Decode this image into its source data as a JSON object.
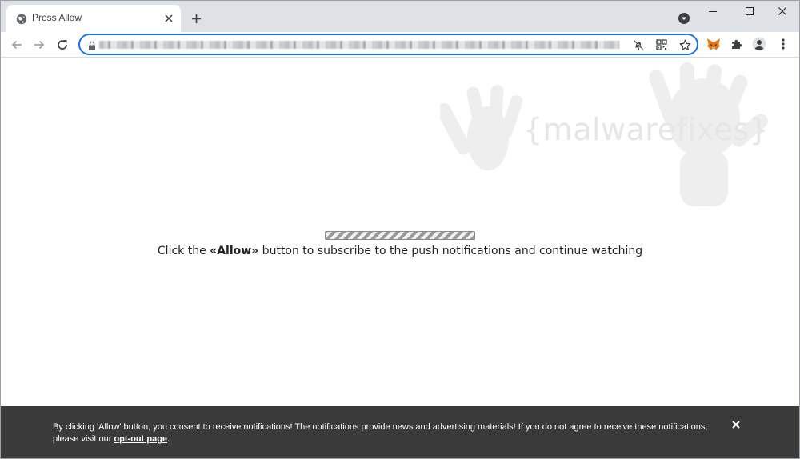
{
  "tab": {
    "title": "Press Allow",
    "favicon": "globe-icon",
    "close": "close-icon",
    "new_tab": "plus-icon"
  },
  "window": {
    "tab_search": "chevron-down-icon",
    "minimize": "minimize-icon",
    "maximize": "maximize-icon",
    "close": "close-icon"
  },
  "toolbar": {
    "back": "back-arrow-icon",
    "forward": "forward-arrow-icon",
    "reload": "reload-icon",
    "omnibox_icons": [
      "lock-icon",
      "notifications-blocked-icon",
      "qr-code-icon",
      "bookmark-star-icon"
    ],
    "extensions": [
      "fox-extension-icon",
      "puzzle-extensions-icon",
      "profile-avatar-icon",
      "more-menu-icon"
    ]
  },
  "page": {
    "watermark_text": "{malwarefixes}",
    "message_before": "Click the ",
    "message_bold": "«Allow»",
    "message_after": " button to subscribe to the push notifications and continue watching"
  },
  "consent": {
    "text": "By clicking 'Allow' button, you consent to receive notifications! The notifications provide news and advertising materials! If you do not agree to receive these notifications, please visit our ",
    "link": "opt-out page",
    "text_end": ".",
    "close": "close-icon"
  },
  "colors": {
    "focus_ring": "#1a73e8",
    "tabstrip": "#dee1e6",
    "banner": "#3a3a3a",
    "extension_fox": "#e2761b"
  }
}
